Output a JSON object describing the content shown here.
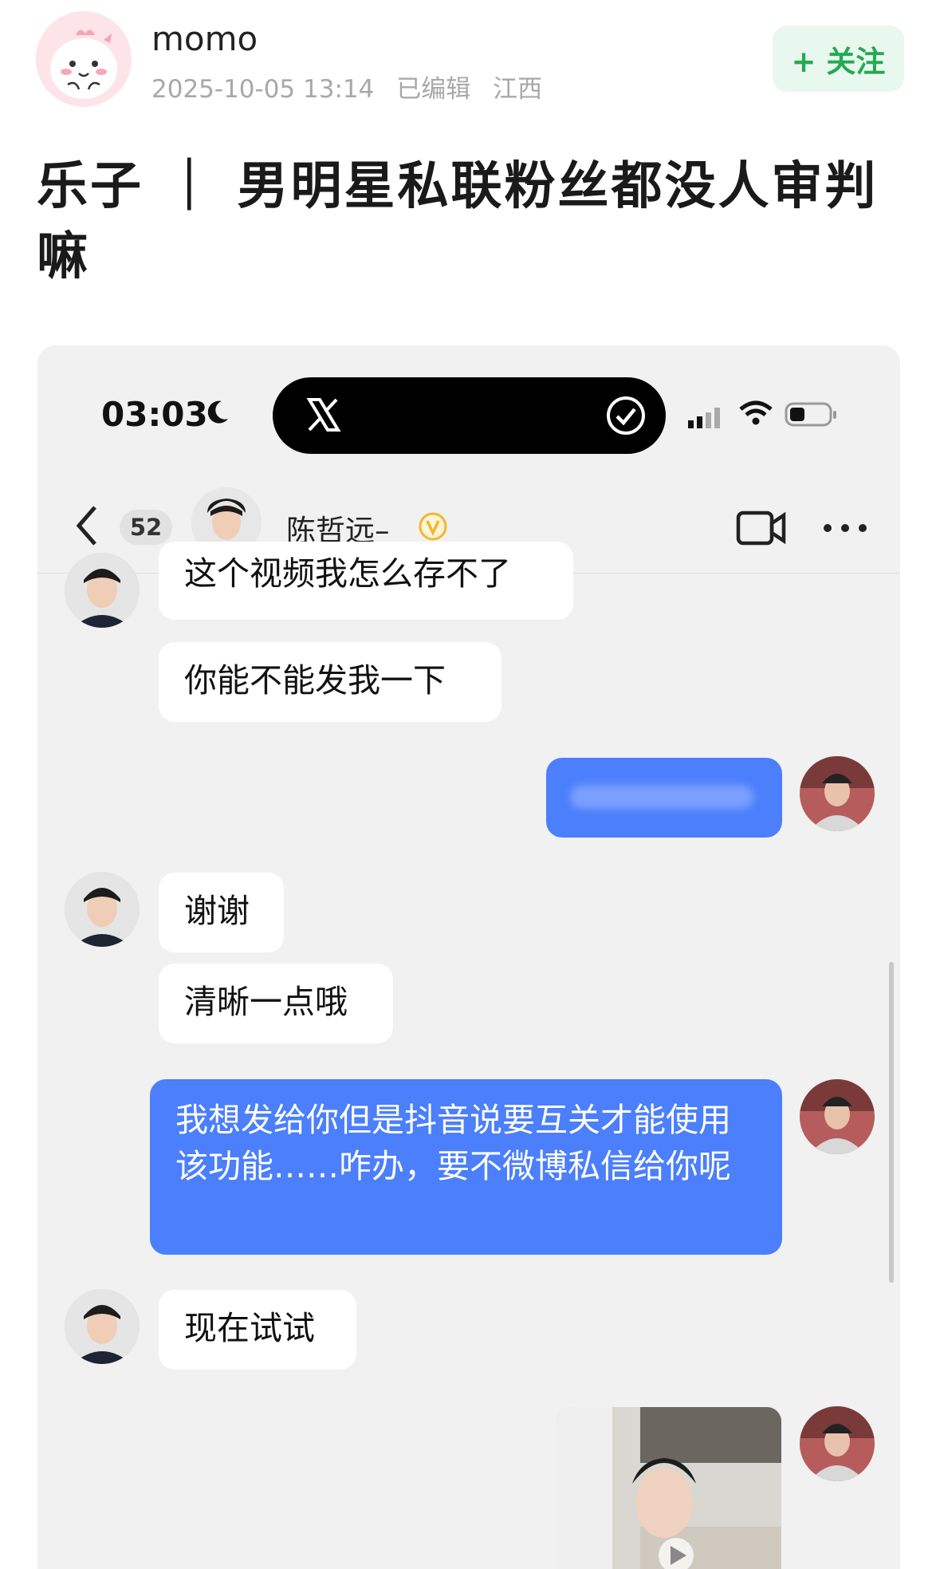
{
  "post": {
    "username": "momo",
    "timestamp": "2025-10-05 13:14",
    "edited": "已编辑",
    "location": "江西",
    "follow_label": "+ 关注",
    "title": "乐子 ｜ 男明星私联粉丝都没人审判嘛"
  },
  "phone": {
    "time": "03:03",
    "island_app": "X",
    "battery_level": 0.4
  },
  "chat": {
    "unread_count": "52",
    "contact_name": "陈哲远–",
    "messages": [
      {
        "from": "them",
        "text": "这个视频我怎么存不了"
      },
      {
        "from": "them",
        "text": "你能不能发我一下"
      },
      {
        "from": "me",
        "text": ""
      },
      {
        "from": "them",
        "text": "谢谢"
      },
      {
        "from": "them",
        "text": "清晰一点哦"
      },
      {
        "from": "me",
        "text": "我想发给你但是抖音说要互关才能使用该功能……咋办，要不微博私信给你呢"
      },
      {
        "from": "them",
        "text": "现在试试"
      },
      {
        "from": "me",
        "type": "video"
      }
    ]
  },
  "colors": {
    "accent_blue": "#4b7ffb",
    "follow_green": "#25a952",
    "follow_bg": "#e9f8ee",
    "verify_gold": "#f2b630"
  }
}
